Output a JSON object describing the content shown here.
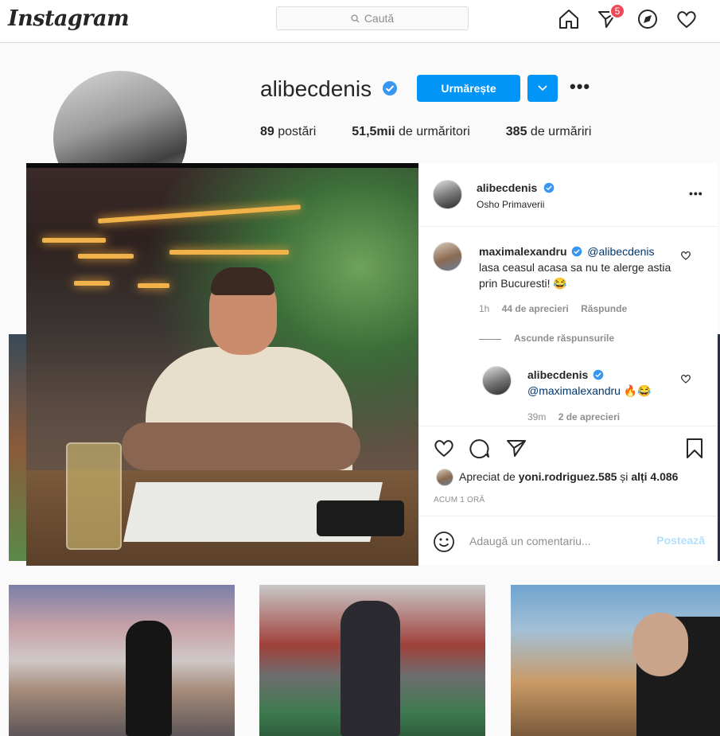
{
  "topbar": {
    "logo": "Instagram",
    "search_placeholder": "Caută",
    "notifications_count": "5"
  },
  "profile": {
    "username": "alibecdenis",
    "follow_label": "Urmărește",
    "stats": [
      {
        "value": "89",
        "label": " postări"
      },
      {
        "value": "51,5mii",
        "label": " de urmăritori"
      },
      {
        "value": "385",
        "label": " de urmăriri"
      }
    ]
  },
  "post": {
    "owner": "alibecdenis",
    "location": "Osho Primaverii",
    "comments": [
      {
        "user": "maximalexandru",
        "mention": "@alibecdenis",
        "text": "lasa ceasul acasa sa nu te alerge astia prin Bucuresti! 😂",
        "time": "1h",
        "likes": "44 de aprecieri",
        "reply": "Răspunde"
      }
    ],
    "hide_replies": "Ascunde răspunsurile",
    "reply": {
      "user": "alibecdenis",
      "mention": "@maximalexandru",
      "emoji": "🔥😂",
      "time": "39m",
      "likes": "2 de aprecieri"
    },
    "liked_by_prefix": "Apreciat de ",
    "liked_by_user": "yoni.rodriguez.585",
    "liked_by_suffix_prefix": " și ",
    "liked_by_others": "alți 4.086",
    "timestamp": "ACUM 1 ORĂ",
    "comment_placeholder": "Adaugă un comentariu...",
    "post_button": "Postează"
  },
  "colors": {
    "accent": "#0095f6",
    "verified": "#3897f0",
    "badge": "#ed4956"
  }
}
